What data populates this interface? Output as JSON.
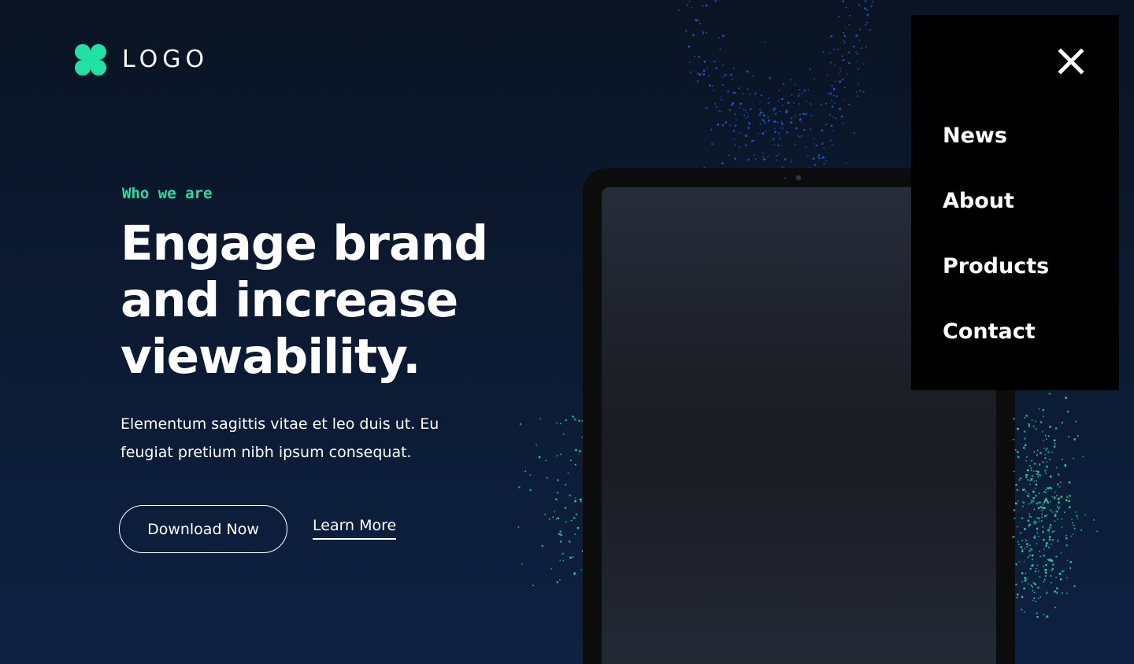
{
  "brand": {
    "logo_text": "LOGO",
    "accent": "#1fe2a3"
  },
  "hero": {
    "eyebrow": "Who we are",
    "title": "Engage brand and increase viewability.",
    "description": "Elementum sagittis vitae et leo duis ut. Eu feugiat pretium nibh ipsum consequat.",
    "primary_button": "Download Now",
    "secondary_link": "Learn More"
  },
  "menu": {
    "close_icon": "close-icon",
    "items": [
      {
        "label": "News"
      },
      {
        "label": "About"
      },
      {
        "label": "Products"
      },
      {
        "label": "Contact"
      }
    ]
  },
  "colors": {
    "background": "#0c1b34",
    "particles_blue": "#1f5fe0",
    "particles_green": "#1fe2a3",
    "menu_background": "#000000"
  }
}
